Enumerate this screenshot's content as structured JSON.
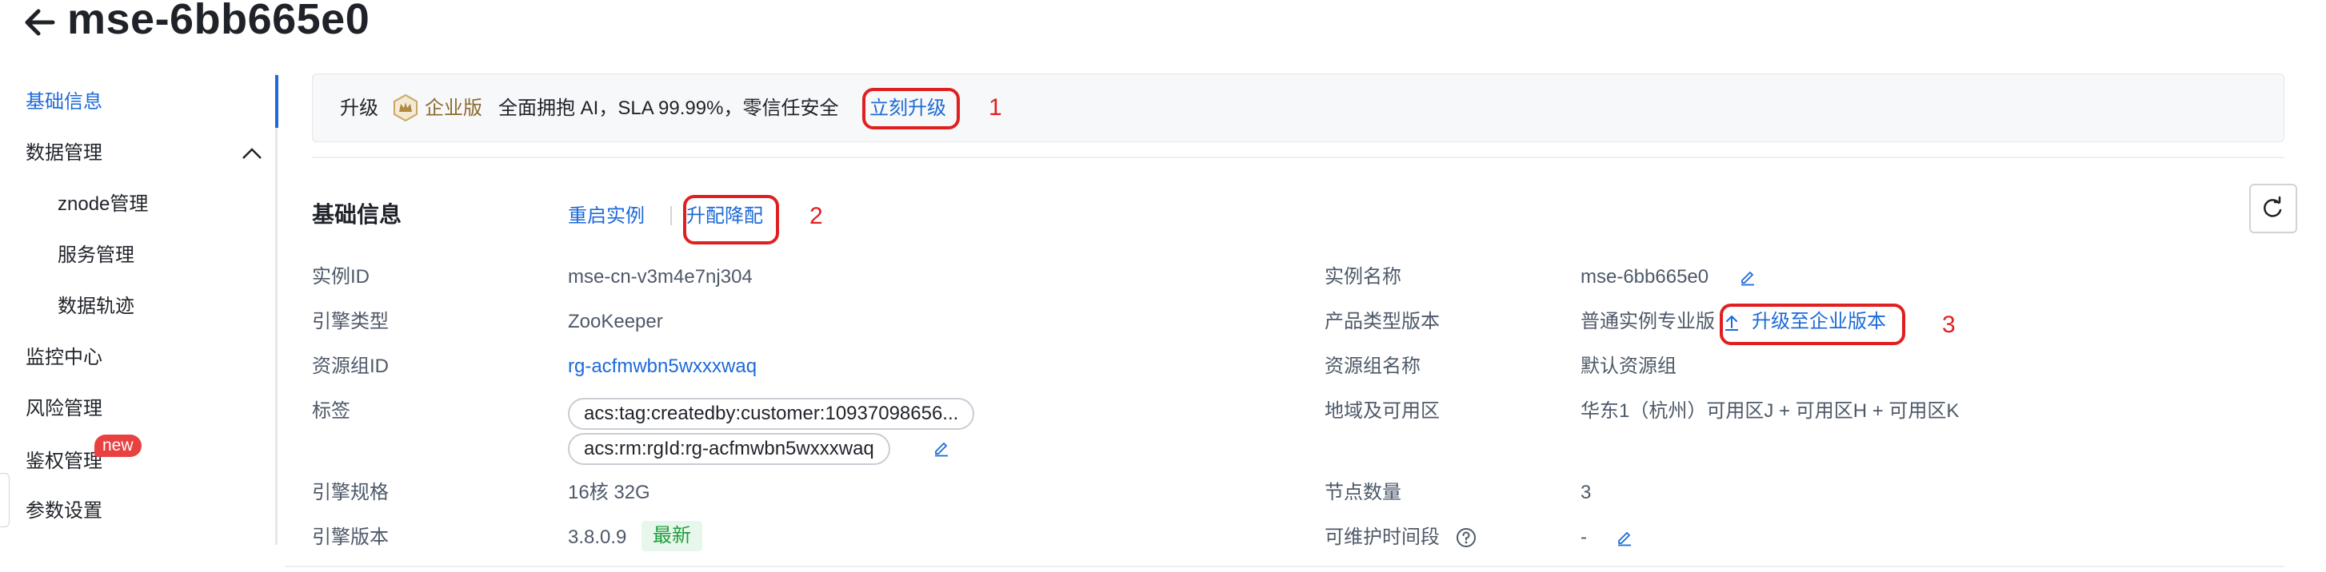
{
  "header": {
    "title": "mse-6bb665e0"
  },
  "sidebar": {
    "items": [
      {
        "label": "基础信息",
        "active": true
      },
      {
        "label": "数据管理",
        "expanded": true
      },
      {
        "label": "znode管理",
        "sub": true
      },
      {
        "label": "服务管理",
        "sub": true
      },
      {
        "label": "数据轨迹",
        "sub": true
      },
      {
        "label": "监控中心"
      },
      {
        "label": "风险管理"
      },
      {
        "label": "鉴权管理",
        "badge": "new"
      },
      {
        "label": "参数设置"
      }
    ]
  },
  "banner": {
    "prefix": "升级",
    "edition": "企业版",
    "description": "全面拥抱 AI，SLA 99.99%，零信任安全",
    "link": "立刻升级",
    "marker": "1"
  },
  "section": {
    "title": "基础信息",
    "actions": {
      "restart": "重启实例",
      "resize": "升配降配",
      "marker": "2"
    }
  },
  "info": {
    "instance_id_label": "实例ID",
    "instance_id": "mse-cn-v3m4e7nj304",
    "engine_type_label": "引擎类型",
    "engine_type": "ZooKeeper",
    "resource_group_id_label": "资源组ID",
    "resource_group_id": "rg-acfmwbn5wxxxwaq",
    "tags_label": "标签",
    "tags": [
      "acs:tag:createdby:customer:10937098656...",
      "acs:rm:rgId:rg-acfmwbn5wxxxwaq"
    ],
    "engine_spec_label": "引擎规格",
    "engine_spec": "16核 32G",
    "engine_version_label": "引擎版本",
    "engine_version": "3.8.0.9",
    "engine_version_badge": "最新",
    "instance_name_label": "实例名称",
    "instance_name": "mse-6bb665e0",
    "product_version_label": "产品类型版本",
    "product_version": "普通实例专业版",
    "upgrade_link": "升级至企业版本",
    "upgrade_marker": "3",
    "resource_group_name_label": "资源组名称",
    "resource_group_name": "默认资源组",
    "region_label": "地域及可用区",
    "region": "华东1（杭州）可用区J + 可用区H + 可用区K",
    "node_count_label": "节点数量",
    "node_count": "3",
    "maintenance_label": "可维护时间段",
    "maintenance": "-"
  },
  "colors": {
    "accent": "#1d6ad8",
    "annotation": "#e02020",
    "badge_new": "#e94141",
    "latest_badge_bg": "#e8f7ec",
    "latest_badge_text": "#1f9d3d"
  },
  "icons": [
    "back-arrow-icon",
    "chevron-up-icon",
    "crown-icon",
    "edit-icon",
    "upload-icon",
    "refresh-icon",
    "help-icon"
  ]
}
